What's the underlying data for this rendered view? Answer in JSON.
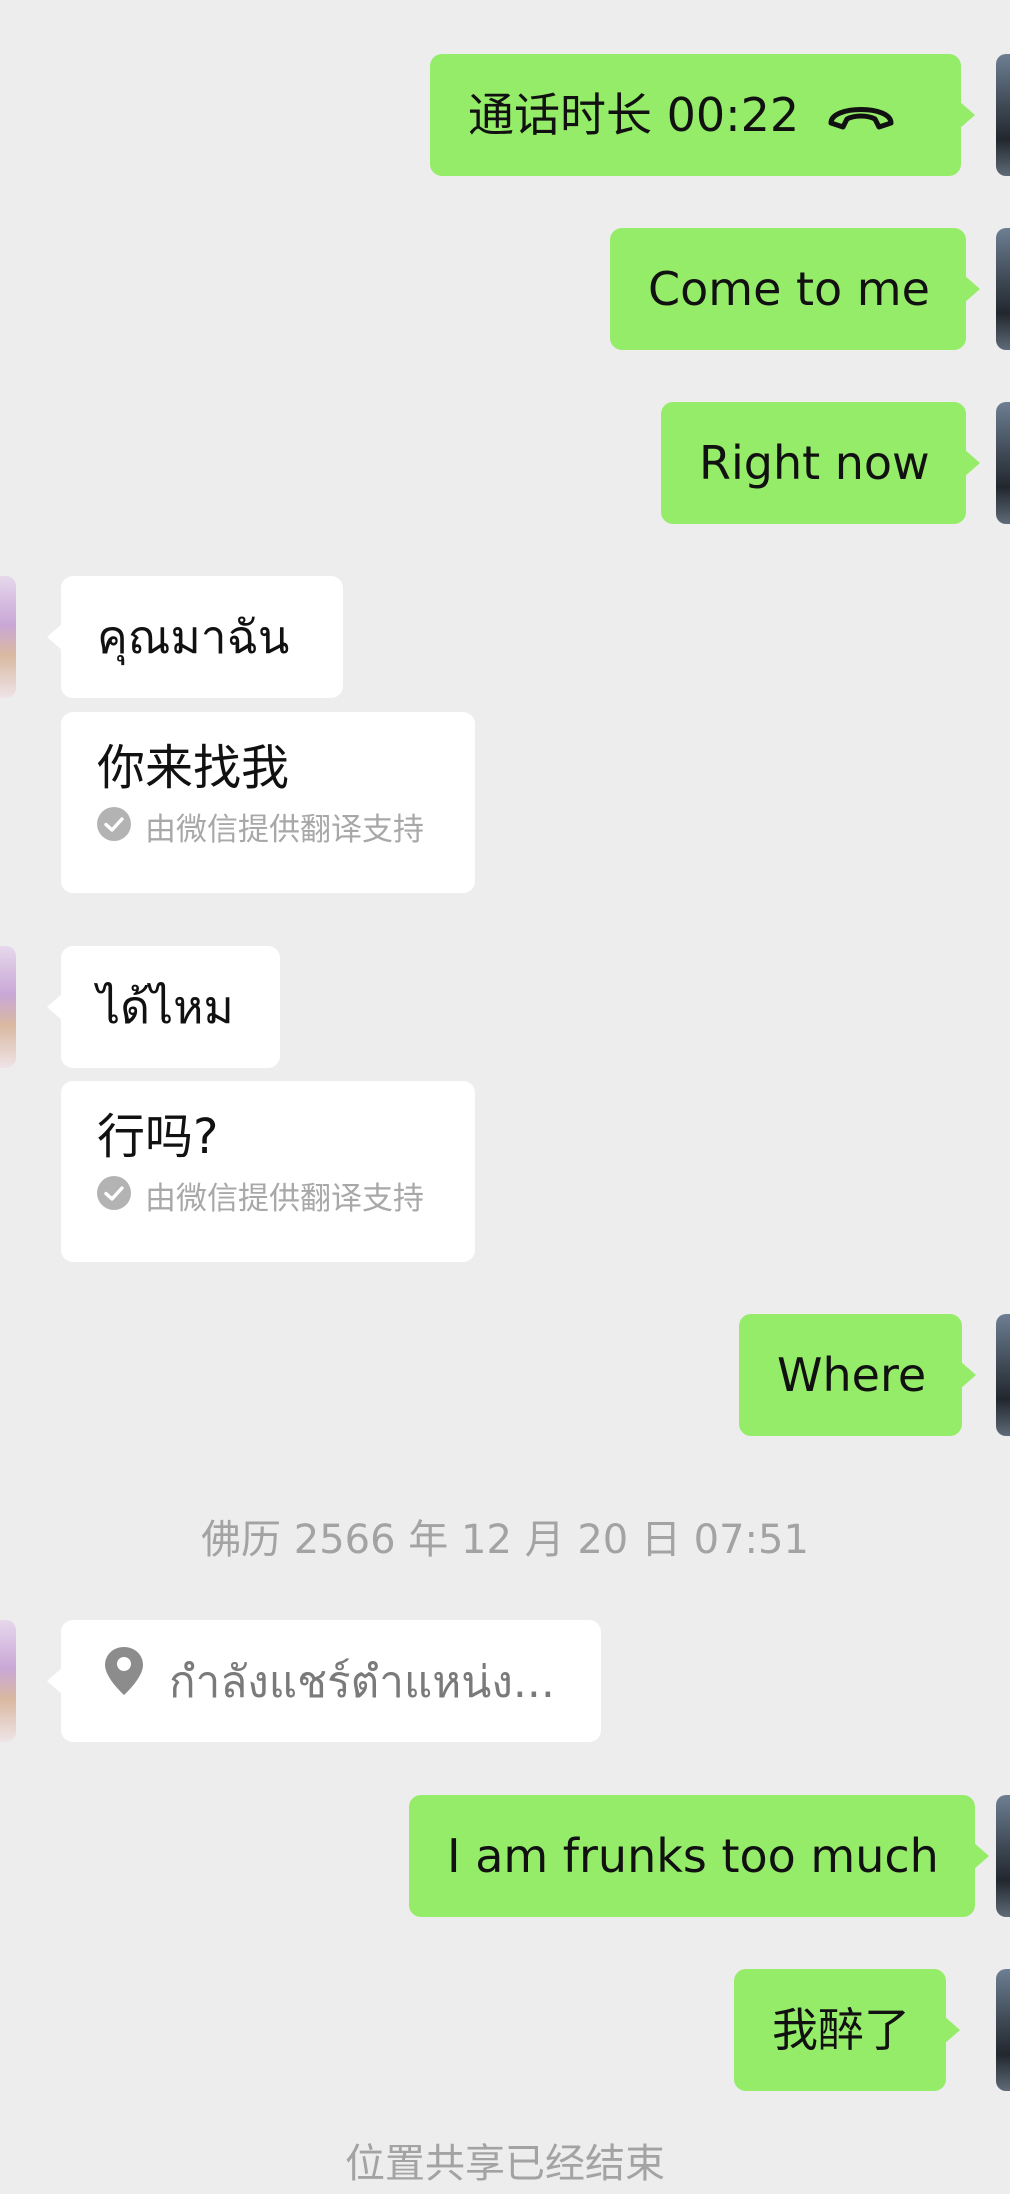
{
  "messages": {
    "call": {
      "text": "通话时长 00:22",
      "icon": "phone-hangup-icon"
    },
    "come_to_me": "Come to me",
    "right_now": "Right now",
    "thai_1": "คุณมาฉัน",
    "translation_1": {
      "text": "你来找我",
      "note": "由微信提供翻译支持"
    },
    "thai_2": "ได้ไหม",
    "translation_2": {
      "text": "行吗?",
      "note": "由微信提供翻译支持"
    },
    "where": "Where",
    "location_share": {
      "text": "กำลังแชร์ตำแหน่ง...",
      "icon": "location-pin-icon"
    },
    "drunk_en": "I am frunks too much",
    "drunk_zh": "我醉了"
  },
  "timestamp": "佛历 2566 年 12 月 20 日 07:51",
  "system_notice": "位置共享已经结束",
  "colors": {
    "background": "#ededed",
    "sent_bubble": "#95ec69",
    "received_bubble": "#ffffff",
    "muted_text": "#a3a3a3"
  }
}
